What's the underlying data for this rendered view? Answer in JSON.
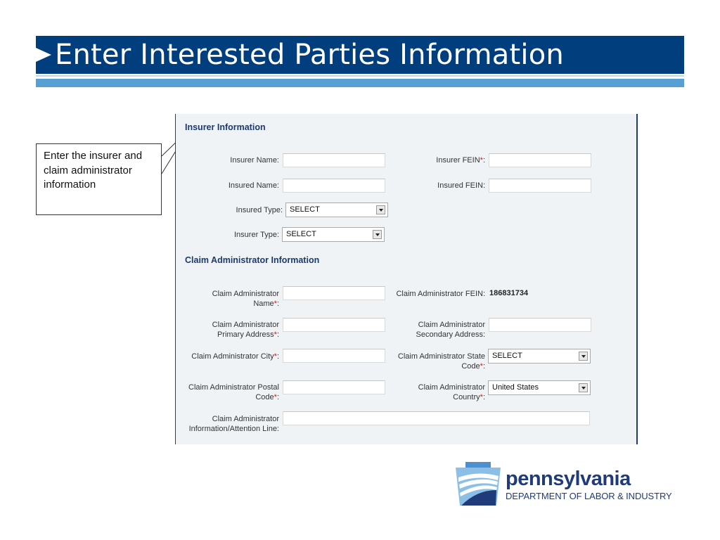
{
  "header": {
    "title": "Enter Interested Parties Information",
    "colors": {
      "title_bg": "#003e7e",
      "accent_bar": "#56a0d3"
    }
  },
  "callout": {
    "text": "Enter the insurer and claim administrator information"
  },
  "insurer_section": {
    "heading": "Insurer Information",
    "fields": {
      "insurer_name": {
        "label": "Insurer Name:",
        "value": ""
      },
      "insured_name": {
        "label": "Insured Name:",
        "value": ""
      },
      "insured_type": {
        "label": "Insured Type:",
        "value": "SELECT"
      },
      "insurer_type": {
        "label": "Insurer Type:",
        "value": "SELECT"
      },
      "insurer_fein": {
        "label": "Insurer FEIN",
        "required_mark": "*",
        "suffix": ":",
        "value": ""
      },
      "insured_fein": {
        "label": "Insured FEIN:",
        "value": ""
      }
    }
  },
  "claim_admin_section": {
    "heading": "Claim Administrator Information",
    "fields": {
      "name": {
        "label_line1": "Claim Administrator",
        "label_line2": "Name",
        "required_mark": "*",
        "suffix": ":",
        "value": ""
      },
      "fein": {
        "label": "Claim Administrator FEIN:",
        "value": "186831734"
      },
      "primary_address": {
        "label_line1": "Claim Administrator",
        "label_line2": "Primary Address",
        "required_mark": "*",
        "suffix": ":",
        "value": ""
      },
      "secondary_address": {
        "label_line1": "Claim Administrator",
        "label_line2": "Secondary Address:",
        "value": ""
      },
      "city": {
        "label": "Claim Administrator City",
        "required_mark": "*",
        "suffix": ":",
        "value": ""
      },
      "state_code": {
        "label_line1": "Claim Administrator State",
        "label_line2": "Code",
        "required_mark": "*",
        "suffix": ":",
        "value": "SELECT"
      },
      "postal_code": {
        "label_line1": "Claim Administrator Postal",
        "label_line2": "Code",
        "required_mark": "*",
        "suffix": ":",
        "value": ""
      },
      "country": {
        "label_line1": "Claim Administrator",
        "label_line2": "Country",
        "required_mark": "*",
        "suffix": ":",
        "value": "United States"
      },
      "attention_line": {
        "label_line1": "Claim Administrator",
        "label_line2": "Information/Attention Line:",
        "value": ""
      }
    }
  },
  "footer_logo": {
    "name": "pennsylvania",
    "department": "DEPARTMENT OF LABOR & INDUSTRY",
    "icon": "keystone-icon"
  }
}
